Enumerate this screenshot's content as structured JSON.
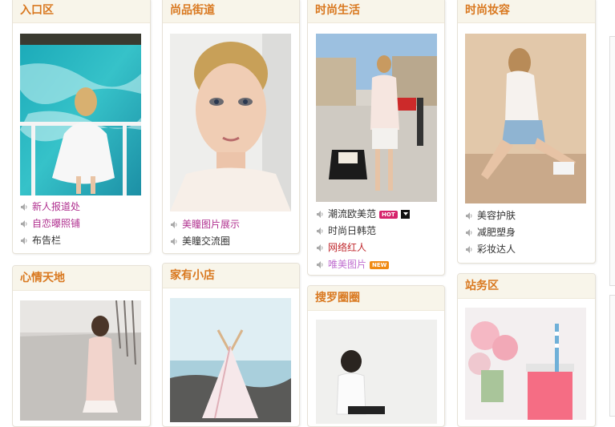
{
  "sections": {
    "entrance": {
      "title": "入口区",
      "links": [
        {
          "label": "新人报道处",
          "color": "#b0308f"
        },
        {
          "label": "自恋曝照铺",
          "color": "#b0308f"
        },
        {
          "label": "布告栏",
          "color": "#333333"
        }
      ]
    },
    "street": {
      "title": "尚品街道",
      "links": [
        {
          "label": "美瞳图片展示",
          "color": "#b0308f"
        },
        {
          "label": "美瞳交流圈",
          "color": "#333333"
        }
      ]
    },
    "life": {
      "title": "时尚生活",
      "links": [
        {
          "label": "潮流欧美范",
          "color": "#333333",
          "badge": "HOT"
        },
        {
          "label": "时尚日韩范",
          "color": "#333333"
        },
        {
          "label": "网络红人",
          "color": "#c0282d"
        },
        {
          "label": "唯美图片",
          "color": "#c070d0",
          "badge": "NEW"
        }
      ]
    },
    "makeup": {
      "title": "时尚妆容",
      "links": [
        {
          "label": "美容护肤",
          "color": "#333333"
        },
        {
          "label": "减肥塑身",
          "color": "#333333"
        },
        {
          "label": "彩妆达人",
          "color": "#333333"
        }
      ]
    },
    "mood": {
      "title": "心情天地"
    },
    "shop": {
      "title": "家有小店"
    },
    "search": {
      "title": "搜罗圈圈"
    },
    "station": {
      "title": "站务区"
    }
  },
  "colors": {
    "header_text": "#d9781f",
    "header_bg": "#f8f5ea"
  }
}
